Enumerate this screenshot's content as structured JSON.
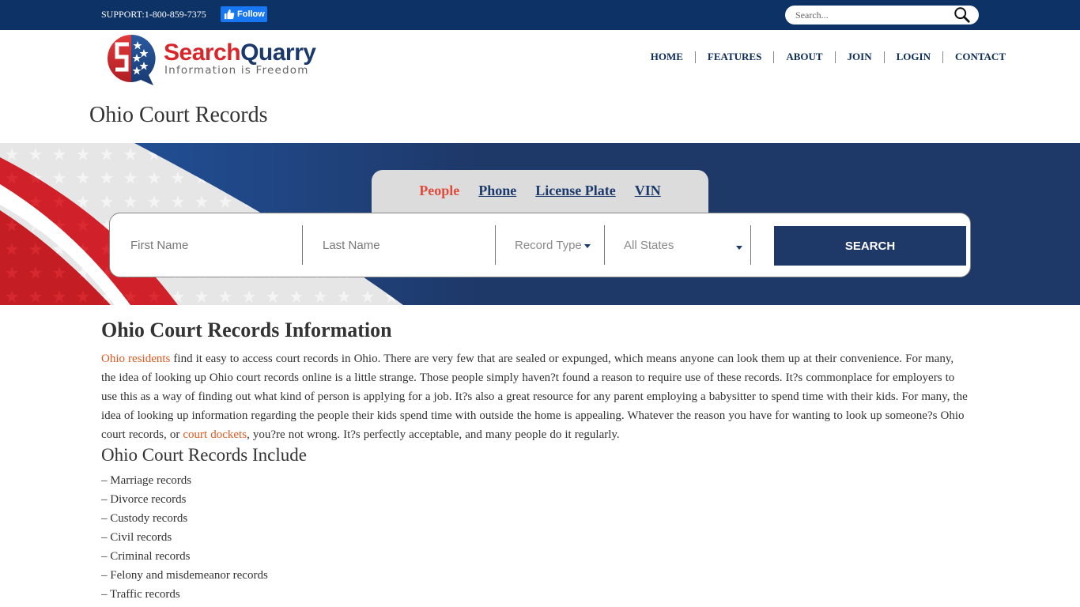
{
  "topbar": {
    "support_text": "SUPPORT:1-800-859-7375",
    "follow_label": "Follow",
    "search_placeholder": "Search...",
    "background_color": "#0c3266"
  },
  "header": {
    "brand_part1": "Search",
    "brand_part2": "Quarry",
    "tagline": "Information is Freedom",
    "nav": [
      {
        "label": "HOME"
      },
      {
        "label": "FEATURES"
      },
      {
        "label": "ABOUT"
      },
      {
        "label": "JOIN"
      },
      {
        "label": "LOGIN"
      },
      {
        "label": "CONTACT"
      }
    ]
  },
  "page_title": "Ohio Court Records",
  "search_panel": {
    "tabs": [
      {
        "label": "People",
        "active": true
      },
      {
        "label": "Phone",
        "active": false
      },
      {
        "label": "License Plate",
        "active": false
      },
      {
        "label": "VIN",
        "active": false
      }
    ],
    "first_name_placeholder": "First Name",
    "last_name_placeholder": "Last Name",
    "record_type_selected": "Record Type",
    "state_selected": "All States",
    "search_button_label": "SEARCH",
    "accent_color": "#1e3868",
    "active_tab_color": "#e04a3a"
  },
  "content": {
    "heading": "Ohio Court Records Information",
    "paragraph": {
      "link1": "Ohio residents",
      "text1": " find it easy to access court records in Ohio. There are very few that are sealed or expunged, which means anyone can look them up at their convenience. For many, the idea of looking up Ohio court records online is a little strange. Those people simply haven?t found a reason to require use of these records. It?s commonplace for employers to use this as a way of finding out what kind of person is applying for a job. It?s also a great resource for any parent employing a babysitter to spend time with their kids. For many, the idea of looking up information regarding the people their kids spend time with outside the home is appealing. Whatever the reason you have for wanting to look up someone?s Ohio court records, or ",
      "link2": "court dockets",
      "text2": ", you?re not wrong. It?s perfectly acceptable, and many people do it regularly."
    },
    "subheading": "Ohio Court Records Include",
    "list": [
      "– Marriage records",
      "– Divorce records",
      "– Custody records",
      "– Civil records",
      "– Criminal records",
      "– Felony and misdemeanor records",
      "– Traffic records"
    ],
    "link_color": "#e05a20"
  }
}
